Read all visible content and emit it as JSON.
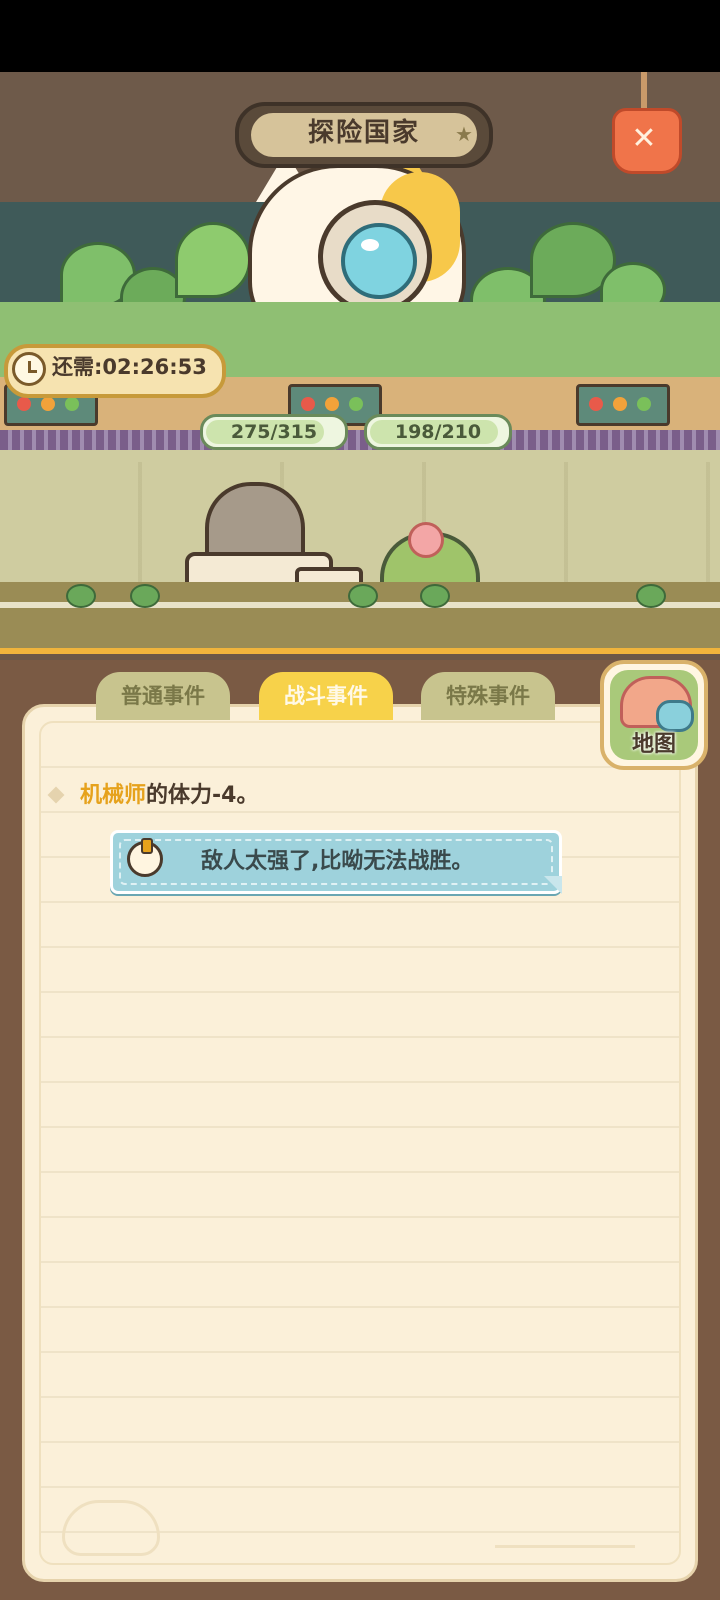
{
  "scene": {
    "title": "探险国家",
    "timer_label": "还需:02:26:53",
    "hp_left": {
      "text": "275/315",
      "current": 275,
      "max": 315
    },
    "hp_right": {
      "text": "198/210",
      "current": 198,
      "max": 210
    },
    "close_icon": "close-tag-icon"
  },
  "tabs": [
    {
      "label": "普通事件",
      "active": false
    },
    {
      "label": "战斗事件",
      "active": true
    },
    {
      "label": "特殊事件",
      "active": false
    }
  ],
  "map_button": {
    "label": "地图"
  },
  "log": {
    "entry_name": "机械师",
    "entry_text": "的体力-4。",
    "message": "敌人太强了,比呦无法战胜。"
  },
  "colors": {
    "active_tab": "#f7d24a",
    "inactive_tab": "#c8c48e",
    "highlight_name": "#e6a21c",
    "bubble": "#9ed2dc"
  }
}
